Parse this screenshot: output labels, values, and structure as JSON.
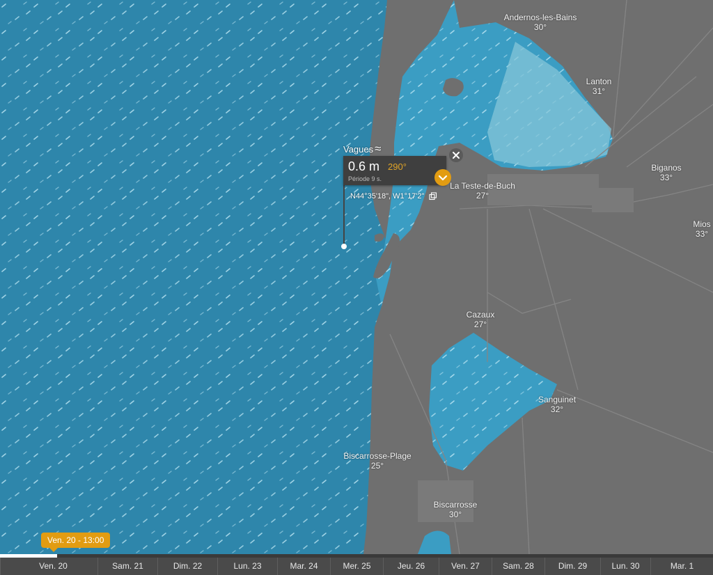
{
  "colors": {
    "ocean": "#2e86ab",
    "ocean_dark": "#2a7fa3",
    "land": "#6f6f6f",
    "lagoon_light": "#86c6d8",
    "accent": "#e29c12",
    "popup_bg": "#3f3f3f"
  },
  "icons": {
    "waves": "waves-icon",
    "expand": "chevron-down-icon",
    "close": "close-icon",
    "copy": "copy-icon",
    "location": "location-pin-icon"
  },
  "popup": {
    "layer": "Vagues",
    "wave_symbol": "≈",
    "height": "0.6 m",
    "direction": "290°",
    "period": "Période 9 s.",
    "coords": "N44°35'18\", W1°17'2\""
  },
  "cities": [
    {
      "name": "Andernos-les-Bains",
      "temp": "30°"
    },
    {
      "name": "Lanton",
      "temp": "31°"
    },
    {
      "name": "Biganos",
      "temp": "33°"
    },
    {
      "name": "La Teste-de-Buch",
      "temp": "27°"
    },
    {
      "name": "Mios",
      "temp": "33°"
    },
    {
      "name": "Cazaux",
      "temp": "27°"
    },
    {
      "name": "Sanguinet",
      "temp": "32°"
    },
    {
      "name": "Biscarrosse-Plage",
      "temp": "25°"
    },
    {
      "name": "Biscarrosse",
      "temp": "30°"
    }
  ],
  "timeline": {
    "current": "Ven. 20 - 13:00",
    "progress": 0.08,
    "days": [
      "Ven. 20",
      "Sam. 21",
      "Dim. 22",
      "Lun. 23",
      "Mar. 24",
      "Mer. 25",
      "Jeu. 26",
      "Ven. 27",
      "Sam. 28",
      "Dim. 29",
      "Lun. 30",
      "Mar. 1"
    ]
  }
}
